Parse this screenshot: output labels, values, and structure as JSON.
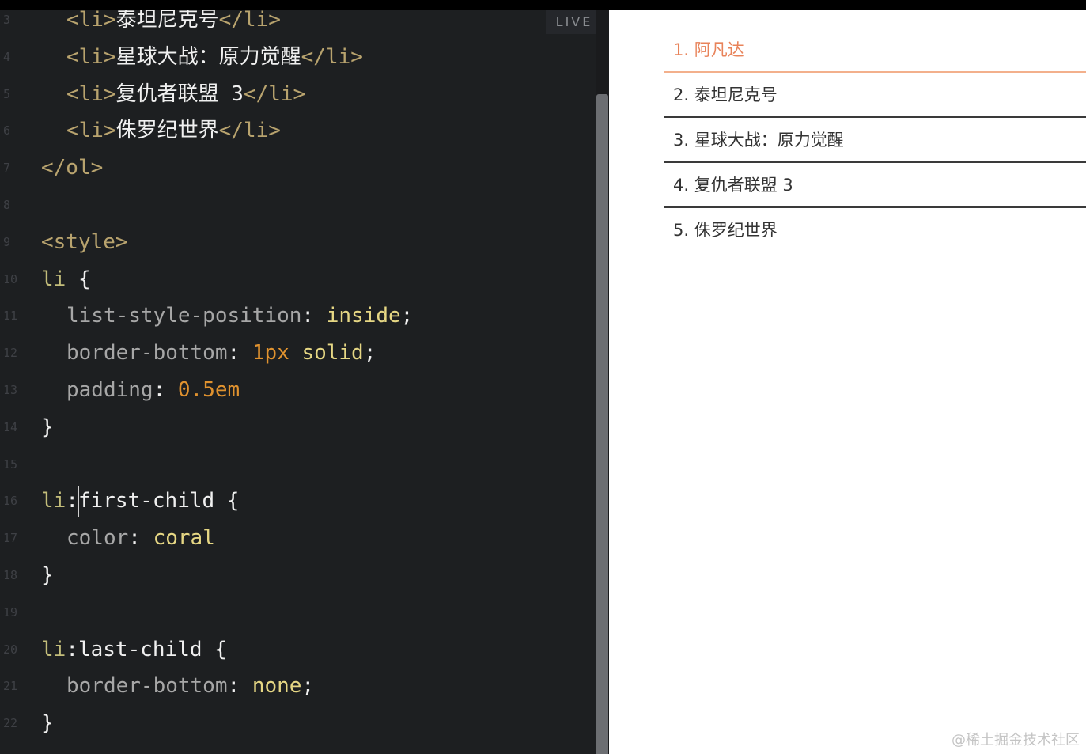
{
  "live_label": "LIVE",
  "editor": {
    "lines": [
      {
        "n": "3",
        "segments": [
          [
            "tag",
            "<li>"
          ],
          [
            "txt",
            "泰坦尼克号"
          ],
          [
            "tag",
            "</li>"
          ]
        ]
      },
      {
        "n": "4",
        "segments": [
          [
            "tag",
            "<li>"
          ],
          [
            "txt",
            "星球大战：原力觉醒"
          ],
          [
            "tag",
            "</li>"
          ]
        ]
      },
      {
        "n": "5",
        "segments": [
          [
            "tag",
            "<li>"
          ],
          [
            "txt",
            "复仇者联盟 3"
          ],
          [
            "tag",
            "</li>"
          ]
        ]
      },
      {
        "n": "6",
        "segments": [
          [
            "tag",
            "<li>"
          ],
          [
            "txt",
            "侏罗纪世界"
          ],
          [
            "tag",
            "</li>"
          ]
        ]
      },
      {
        "n": "7",
        "segments": [
          [
            "tag",
            "</ol>"
          ]
        ]
      },
      {
        "n": "8",
        "segments": []
      },
      {
        "n": "9",
        "segments": [
          [
            "tag",
            "<style>"
          ]
        ]
      },
      {
        "n": "10",
        "segments": [
          [
            "sel",
            "li"
          ],
          [
            "punc",
            " {"
          ]
        ]
      },
      {
        "n": "11",
        "segments": [
          [
            "prop",
            "list-style-position"
          ],
          [
            "punc",
            ": "
          ],
          [
            "kw",
            "inside"
          ],
          [
            "punc",
            ";"
          ]
        ]
      },
      {
        "n": "12",
        "segments": [
          [
            "prop",
            "border-bottom"
          ],
          [
            "punc",
            ": "
          ],
          [
            "num",
            "1px"
          ],
          [
            "punc",
            " "
          ],
          [
            "kw",
            "solid"
          ],
          [
            "punc",
            ";"
          ]
        ]
      },
      {
        "n": "13",
        "segments": [
          [
            "prop",
            "padding"
          ],
          [
            "punc",
            ": "
          ],
          [
            "num",
            "0.5em"
          ]
        ]
      },
      {
        "n": "14",
        "segments": [
          [
            "punc",
            "}"
          ]
        ]
      },
      {
        "n": "15",
        "segments": []
      },
      {
        "n": "16",
        "segments": [
          [
            "sel",
            "li"
          ],
          [
            "punc",
            ":"
          ],
          [
            "cursor",
            ""
          ],
          [
            "punc",
            "first-child {"
          ]
        ]
      },
      {
        "n": "17",
        "segments": [
          [
            "prop",
            "color"
          ],
          [
            "punc",
            ": "
          ],
          [
            "kw",
            "coral"
          ]
        ]
      },
      {
        "n": "18",
        "segments": [
          [
            "punc",
            "}"
          ]
        ]
      },
      {
        "n": "19",
        "segments": []
      },
      {
        "n": "20",
        "segments": [
          [
            "sel",
            "li"
          ],
          [
            "punc",
            ":last-child {"
          ]
        ]
      },
      {
        "n": "21",
        "segments": [
          [
            "prop",
            "border-bottom"
          ],
          [
            "punc",
            ": "
          ],
          [
            "kw",
            "none"
          ],
          [
            "punc",
            ";"
          ]
        ]
      },
      {
        "n": "22",
        "segments": [
          [
            "punc",
            "}"
          ]
        ]
      }
    ]
  },
  "preview": {
    "items": [
      "1. 阿凡达",
      "2. 泰坦尼克号",
      "3. 星球大战：原力觉醒",
      "4. 复仇者联盟 3",
      "5. 侏罗纪世界"
    ]
  },
  "watermark": "@稀土掘金技术社区",
  "colors": {
    "editor_bg": "#1d1f21",
    "tag": "#b8a36e",
    "keyword": "#e6d784",
    "number": "#e0922f",
    "property": "#a7a7a7",
    "coral": "#e8835a"
  }
}
